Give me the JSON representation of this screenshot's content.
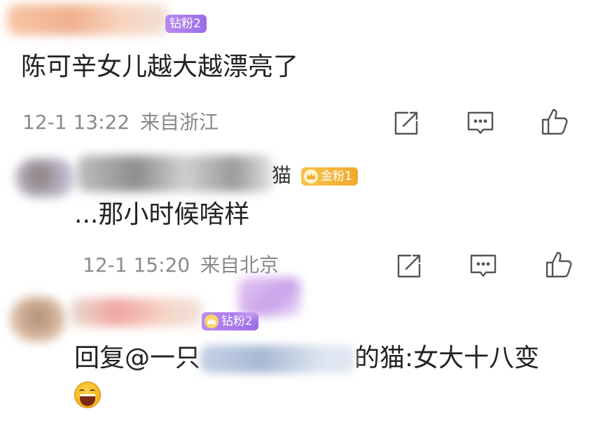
{
  "comments": [
    {
      "badge": "钻粉2",
      "text": "陈可辛女儿越大越漂亮了",
      "time": "12-1 13:22",
      "location": "来自浙江"
    },
    {
      "badge": "金粉1",
      "text": "...那小时候啥样",
      "time": "12-1 15:20",
      "location": "来自北京"
    },
    {
      "badge": "钻粉2",
      "reply_prefix": "回复@一只",
      "reply_mid": "的猫:女大十八变",
      "emoji": "laughing-face-emoji"
    }
  ],
  "partial_username_glyph": "猫",
  "colors": {
    "text": "#222222",
    "meta": "#8a8a8a",
    "icon": "#555555",
    "badge_purple": "#a77bec",
    "badge_gold": "#f3b43a"
  }
}
